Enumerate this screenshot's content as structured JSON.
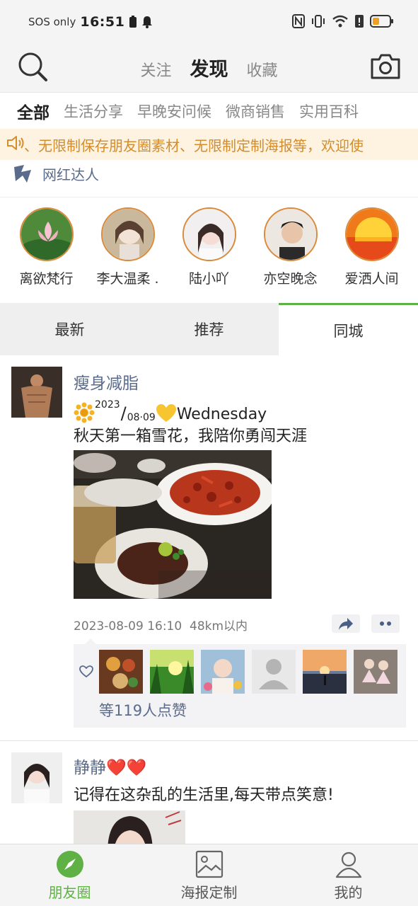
{
  "status_bar": {
    "carrier": "SOS only",
    "time": "16:51"
  },
  "top_nav": {
    "tabs": [
      {
        "label": "关注",
        "active": false
      },
      {
        "label": "发现",
        "active": true
      },
      {
        "label": "收藏",
        "active": false
      }
    ]
  },
  "categories": [
    {
      "label": "全部",
      "active": true
    },
    {
      "label": "生活分享",
      "active": false
    },
    {
      "label": "早晚安问候",
      "active": false
    },
    {
      "label": "微商销售",
      "active": false
    },
    {
      "label": "实用百科",
      "active": false
    }
  ],
  "marquee": {
    "text": "、无限制保存朋友圈素材、无限制定制海报等，欢迎使"
  },
  "influencer_section": {
    "title": "网红达人",
    "people": [
      {
        "name": "离欲梵行"
      },
      {
        "name": "李大温柔 ."
      },
      {
        "name": "陆小吖"
      },
      {
        "name": "亦空晚念"
      },
      {
        "name": "爱洒人间"
      }
    ]
  },
  "sort_tabs": [
    {
      "label": "最新",
      "active": false
    },
    {
      "label": "推荐",
      "active": false
    },
    {
      "label": "同城",
      "active": true
    }
  ],
  "posts": [
    {
      "author": "瘦身减脂",
      "line1_year": "2023",
      "line1_date": "08·09",
      "line1_day": "Wednesday",
      "text": "秋天第一箱雪花，我陪你勇闯天涯",
      "timestamp": "2023-08-09 16:10",
      "distance": "48km以内",
      "like_summary": "等119人点赞"
    },
    {
      "author": "静静❤️❤️",
      "text": "记得在这杂乱的生活里,每天带点笑意!"
    }
  ],
  "bottom_nav": [
    {
      "label": "朋友圈",
      "active": true
    },
    {
      "label": "海报定制",
      "active": false
    },
    {
      "label": "我的",
      "active": false
    }
  ],
  "colors": {
    "accent": "#5fb146",
    "link": "#5a6b8c",
    "banner_text": "#d48c2c",
    "banner_bg": "#fdf3e0"
  }
}
